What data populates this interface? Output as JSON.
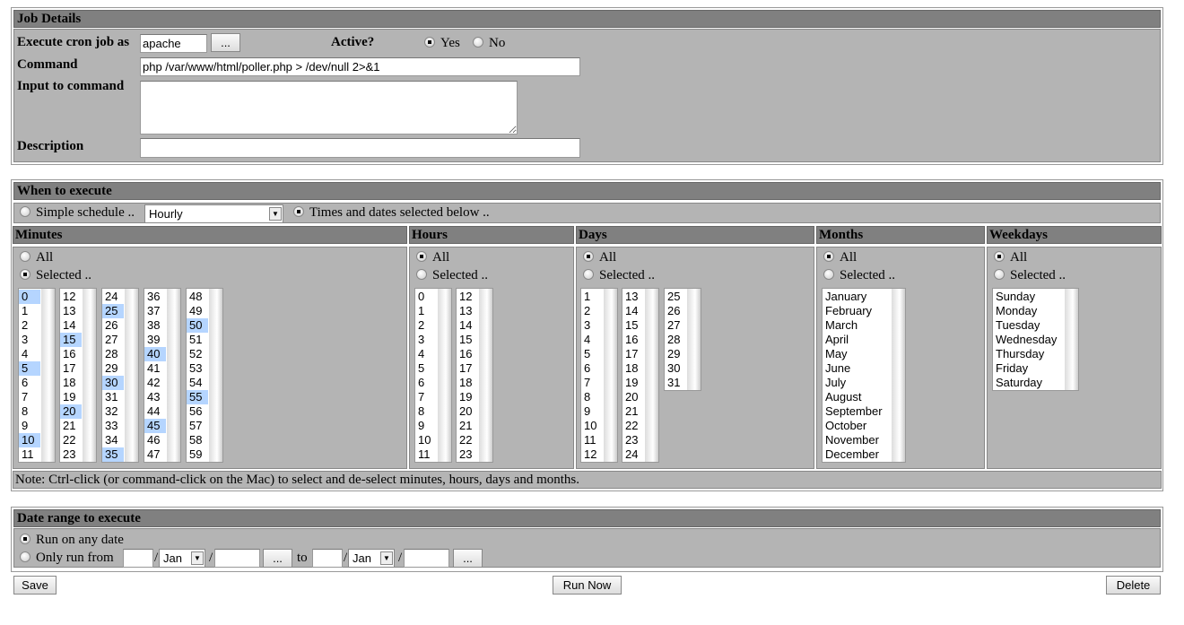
{
  "job_details": {
    "title": "Job Details",
    "run_as_label": "Execute cron job as",
    "run_as_value": "apache",
    "browse_label": "...",
    "active_label": "Active?",
    "active_yes": "Yes",
    "active_no": "No",
    "active_value": "Yes",
    "command_label": "Command",
    "command_value": "php /var/www/html/poller.php > /dev/null 2>&1",
    "input_label": "Input to command",
    "input_value": "",
    "description_label": "Description",
    "description_value": ""
  },
  "when": {
    "title": "When to execute",
    "simple_label": "Simple schedule ..",
    "simple_value": "Hourly",
    "times_label": "Times and dates selected below ..",
    "mode": "times",
    "minutes": {
      "title": "Minutes",
      "all": "All",
      "selected": "Selected ..",
      "mode": "selected",
      "selected_values": [
        "0",
        "5",
        "10",
        "15",
        "20",
        "25",
        "30",
        "35",
        "40",
        "45",
        "50",
        "55"
      ]
    },
    "hours": {
      "title": "Hours",
      "all": "All",
      "selected": "Selected ..",
      "mode": "all"
    },
    "days": {
      "title": "Days",
      "all": "All",
      "selected": "Selected ..",
      "mode": "all"
    },
    "months": {
      "title": "Months",
      "all": "All",
      "selected": "Selected ..",
      "mode": "all",
      "options": [
        "January",
        "February",
        "March",
        "April",
        "May",
        "June",
        "July",
        "August",
        "September",
        "October",
        "November",
        "December"
      ]
    },
    "weekdays": {
      "title": "Weekdays",
      "all": "All",
      "selected": "Selected ..",
      "mode": "all",
      "options": [
        "Sunday",
        "Monday",
        "Tuesday",
        "Wednesday",
        "Thursday",
        "Friday",
        "Saturday"
      ]
    },
    "note": "Note: Ctrl-click (or command-click on the Mac) to select and de-select minutes, hours, days and months."
  },
  "date_range": {
    "title": "Date range to execute",
    "any_label": "Run on any date",
    "range_label": "Only run from",
    "to_label": "to",
    "from_month": "Jan",
    "to_month": "Jan",
    "browse_label": "...",
    "slash": "/",
    "mode": "any"
  },
  "buttons": {
    "save": "Save",
    "run_now": "Run Now",
    "delete": "Delete"
  },
  "colors": {
    "header": "#808080",
    "panel": "#b4b4b4",
    "selection": "#b5d5ff"
  }
}
